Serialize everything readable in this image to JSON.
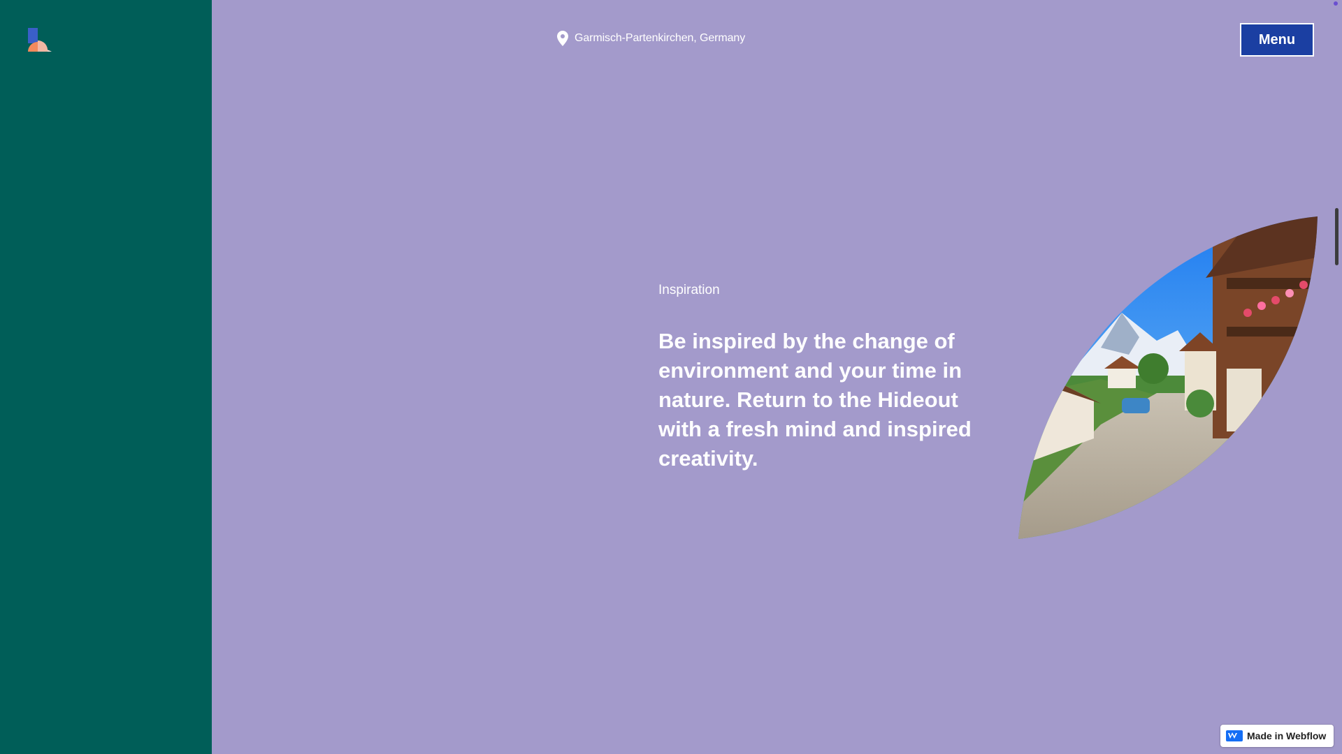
{
  "header": {
    "location": "Garmisch-Partenkirchen, Germany",
    "menu_label": "Menu"
  },
  "icons": {
    "logo": "brand-logo-icon",
    "location": "map-pin-icon",
    "webflow": "webflow-logo-icon"
  },
  "main": {
    "eyebrow": "Inspiration",
    "headline": "Be inspired by the change of environment and your time in nature. Return to the Hideout with a fresh mind and inspired creativity."
  },
  "badge": {
    "label": "Made in Webflow"
  },
  "colors": {
    "background": "#a39acb",
    "sidebar": "#005e58",
    "menu_button": "#1b3fa2",
    "text": "#ffffff"
  }
}
